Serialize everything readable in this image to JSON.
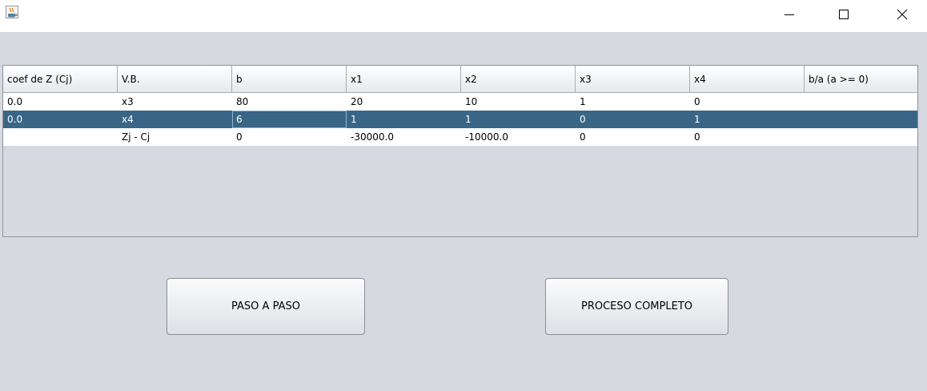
{
  "window": {
    "app_icon": "java-cup-icon",
    "controls": [
      "minimize-icon",
      "maximize-icon",
      "close-icon"
    ]
  },
  "table": {
    "headers": [
      "coef de Z (Cj)",
      "V.B.",
      "b",
      "x1",
      "x2",
      "x3",
      "x4",
      "b/a (a >= 0)"
    ],
    "rows": [
      [
        "0.0",
        "x3",
        "80",
        "20",
        "10",
        "1",
        "0",
        ""
      ],
      [
        "0.0",
        "x4",
        "6",
        "1",
        "1",
        "0",
        "1",
        ""
      ],
      [
        "",
        "Zj - Cj",
        "0",
        "-30000.0",
        "-10000.0",
        "0",
        "0",
        ""
      ]
    ],
    "selected_row": 1,
    "colors": {
      "selection": "#396686",
      "header_border": "#a8acb3"
    }
  },
  "buttons": {
    "step_label": "PASO A PASO",
    "full_label": "PROCESO COMPLETO"
  }
}
